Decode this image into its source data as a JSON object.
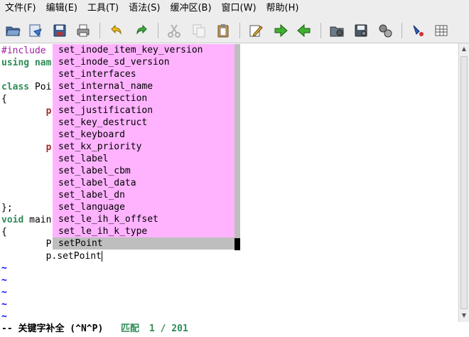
{
  "menubar": [
    "文件(F)",
    "编辑(E)",
    "工具(T)",
    "语法(S)",
    "缓冲区(B)",
    "窗口(W)",
    "帮助(H)"
  ],
  "toolbar": {
    "icons": [
      "open-folder-icon",
      "load-session-icon",
      "save-icon",
      "print-icon",
      "undo-icon",
      "redo-icon",
      "cut-icon",
      "copy-icon",
      "paste-icon",
      "find-replace-icon",
      "find-next-icon",
      "find-previous-icon",
      "load-script-icon",
      "save-session-icon",
      "run-script-icon",
      "make-icon",
      "tag-jump-icon"
    ]
  },
  "editor": {
    "lines": [
      {
        "parts": [
          {
            "t": "#include ",
            "c": "kw-pre"
          }
        ]
      },
      {
        "parts": [
          {
            "t": "using nam",
            "c": "kw-type"
          }
        ]
      },
      {
        "parts": [
          {
            "t": "",
            "c": ""
          }
        ]
      },
      {
        "parts": [
          {
            "t": "class ",
            "c": "kw-type"
          },
          {
            "t": "Poi",
            "c": ""
          }
        ]
      },
      {
        "parts": [
          {
            "t": "{",
            "c": ""
          }
        ]
      },
      {
        "parts": [
          {
            "t": "        ",
            "c": ""
          },
          {
            "t": "p",
            "c": "kw-stmt"
          }
        ]
      },
      {
        "parts": [
          {
            "t": "",
            "c": ""
          }
        ]
      },
      {
        "parts": [
          {
            "t": "",
            "c": ""
          }
        ]
      },
      {
        "parts": [
          {
            "t": "        ",
            "c": ""
          },
          {
            "t": "p",
            "c": "kw-stmt"
          }
        ]
      },
      {
        "parts": [
          {
            "t": "",
            "c": ""
          }
        ]
      },
      {
        "parts": [
          {
            "t": "",
            "c": ""
          }
        ]
      },
      {
        "parts": [
          {
            "t": "",
            "c": ""
          }
        ]
      },
      {
        "parts": [
          {
            "t": "",
            "c": ""
          }
        ]
      },
      {
        "parts": [
          {
            "t": "};",
            "c": ""
          }
        ]
      },
      {
        "parts": [
          {
            "t": "void ",
            "c": "kw-type"
          },
          {
            "t": "main",
            "c": ""
          }
        ]
      },
      {
        "parts": [
          {
            "t": "{",
            "c": ""
          }
        ]
      },
      {
        "parts": [
          {
            "t": "        P",
            "c": ""
          }
        ]
      },
      {
        "parts": [
          {
            "t": "        p.setPoint",
            "c": ""
          }
        ],
        "cursor": true
      }
    ],
    "tildes": [
      "~",
      "~",
      "~",
      "~",
      "~"
    ]
  },
  "completion_popup": {
    "items": [
      "set_inode_item_key_version",
      "set_inode_sd_version",
      "set_interfaces",
      "set_internal_name",
      "set_intersection",
      "set_justification",
      "set_key_destruct",
      "set_keyboard",
      "set_kx_priority",
      "set_label",
      "set_label_cbm",
      "set_label_data",
      "set_label_dn",
      "set_language",
      "set_le_ih_k_offset",
      "set_le_ih_k_type",
      "setPoint"
    ],
    "selected_index": 16
  },
  "status": {
    "mode": "-- 关键字补全 (^N^P)",
    "match": "匹配",
    "count": "1 / 201"
  }
}
